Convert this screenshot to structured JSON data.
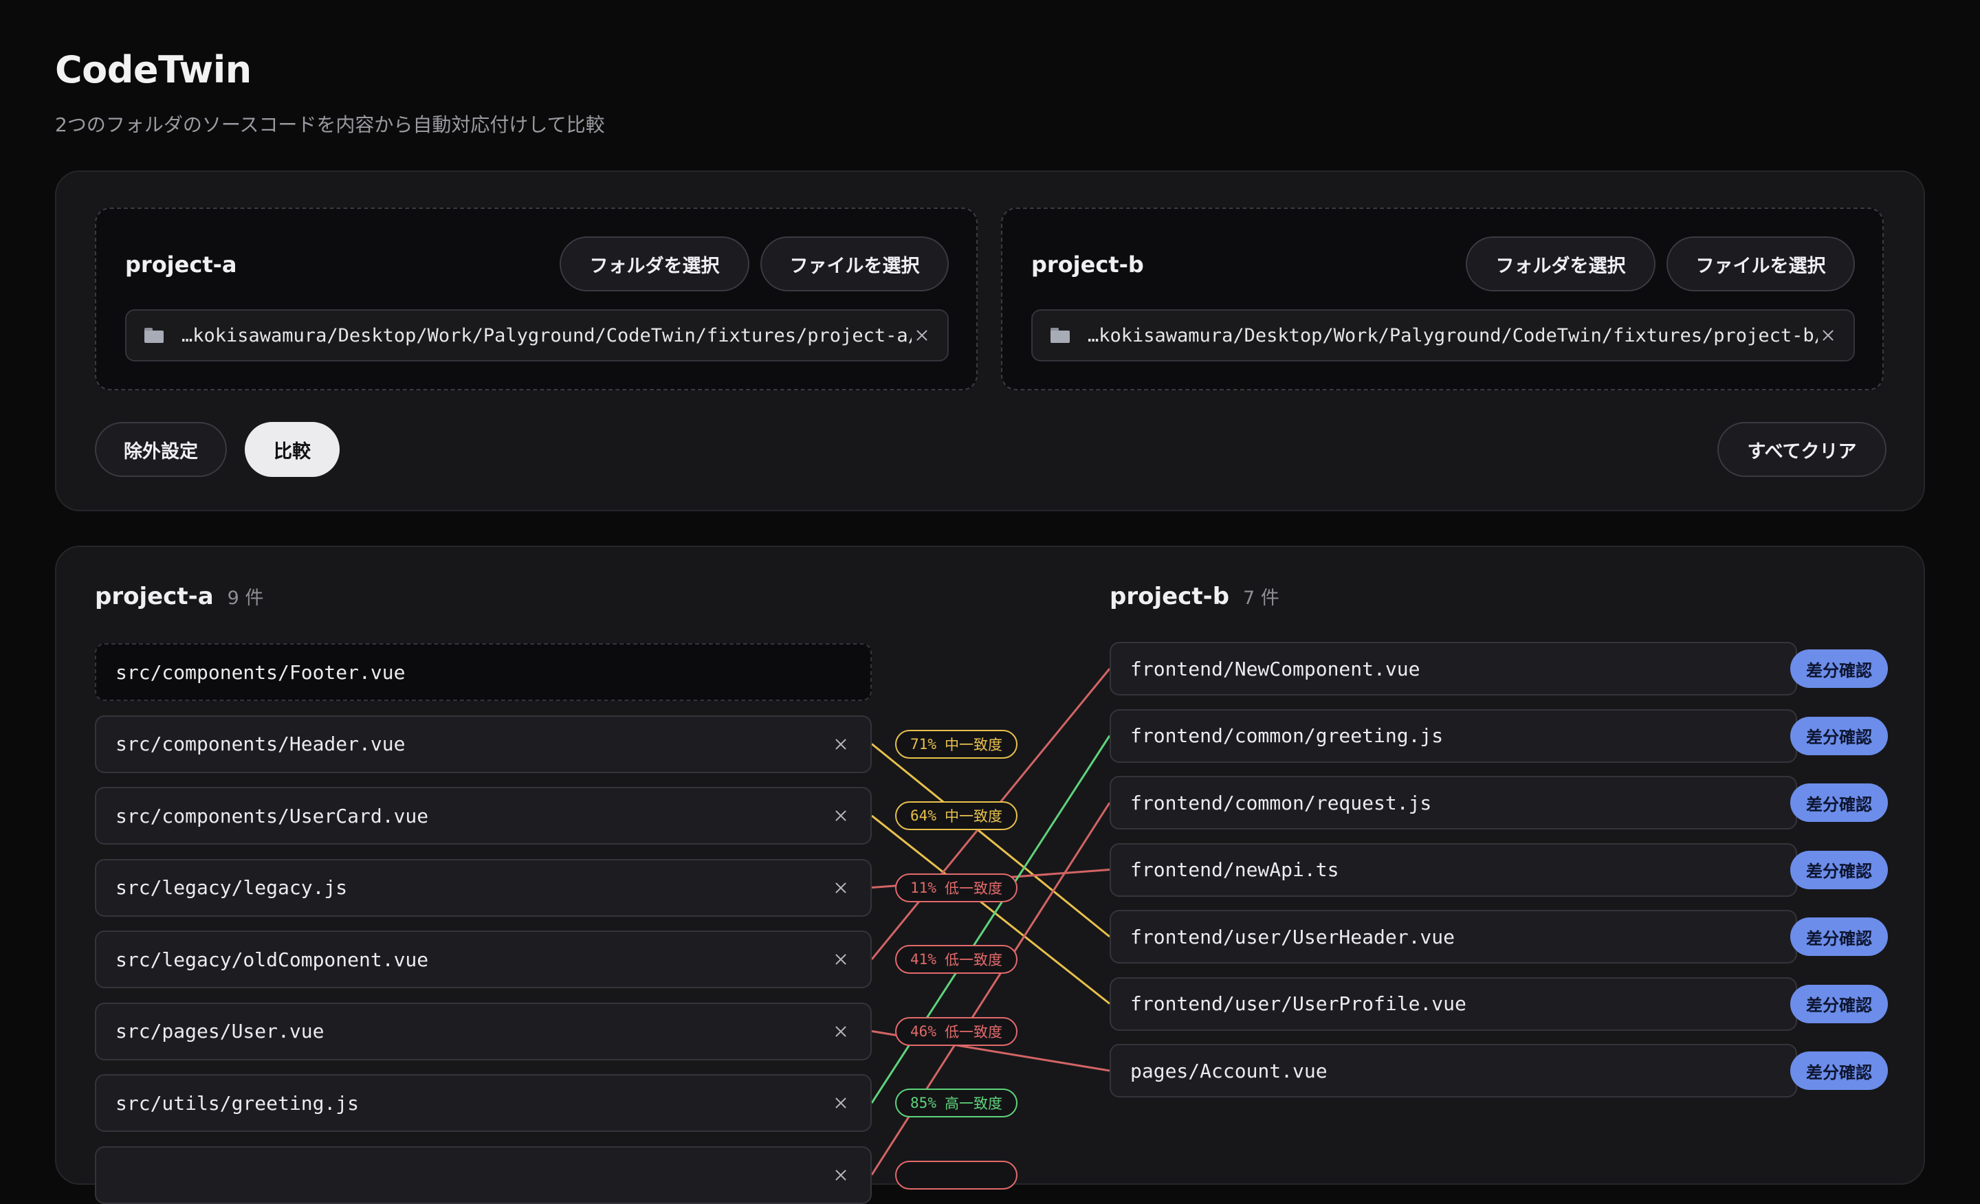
{
  "header": {
    "title": "CodeTwin",
    "subtitle": "2つのフォルダのソースコードを内容から自動対応付けして比較"
  },
  "inputs": {
    "a": {
      "label": "project-a",
      "folder_button": "フォルダを選択",
      "file_button": "ファイルを選択",
      "path": "…kokisawamura/Desktop/Work/Palyground/CodeTwin/fixtures/project-a/"
    },
    "b": {
      "label": "project-b",
      "folder_button": "フォルダを選択",
      "file_button": "ファイルを選択",
      "path": "…kokisawamura/Desktop/Work/Palyground/CodeTwin/fixtures/project-b/"
    }
  },
  "actions": {
    "exclude": "除外設定",
    "compare": "比較",
    "clear_all": "すべてクリア"
  },
  "results": {
    "a": {
      "title": "project-a",
      "count": "9 件",
      "files": [
        "src/components/Footer.vue",
        "src/components/Header.vue",
        "src/components/UserCard.vue",
        "src/legacy/legacy.js",
        "src/legacy/oldComponent.vue",
        "src/pages/User.vue",
        "src/utils/greeting.js",
        ""
      ]
    },
    "b": {
      "title": "project-b",
      "count": "7 件",
      "diff_label": "差分確認",
      "files": [
        "frontend/NewComponent.vue",
        "frontend/common/greeting.js",
        "frontend/common/request.js",
        "frontend/newApi.ts",
        "frontend/user/UserHeader.vue",
        "frontend/user/UserProfile.vue",
        "pages/Account.vue"
      ]
    },
    "matches": [
      {
        "from": 1,
        "to": 4,
        "percent": "71%",
        "level": "中一致度",
        "class": "mid"
      },
      {
        "from": 2,
        "to": 5,
        "percent": "64%",
        "level": "中一致度",
        "class": "mid"
      },
      {
        "from": 3,
        "to": 3,
        "percent": "11%",
        "level": "低一致度",
        "class": "low"
      },
      {
        "from": 4,
        "to": 0,
        "percent": "41%",
        "level": "低一致度",
        "class": "low"
      },
      {
        "from": 5,
        "to": 6,
        "percent": "46%",
        "level": "低一致度",
        "class": "low"
      },
      {
        "from": 6,
        "to": 1,
        "percent": "85%",
        "level": "高一致度",
        "class": "high"
      },
      {
        "from": 7,
        "to": 2,
        "percent": "",
        "level": "",
        "class": "low"
      }
    ],
    "colors": {
      "mid": "#e8c14c",
      "low": "#d36464",
      "high": "#5fd37c"
    }
  }
}
